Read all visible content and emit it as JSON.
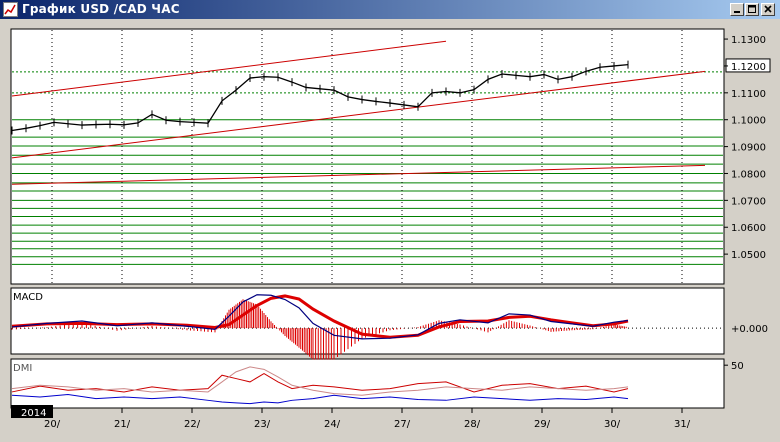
{
  "window": {
    "title": "График USD /CAD  ЧАС",
    "badge_year": "2014",
    "icons": {
      "app": "chart-app-icon",
      "minimize": "minimize-icon",
      "maximize": "maximize-icon",
      "close": "close-icon"
    }
  },
  "colors": {
    "background": "#ffffff",
    "chrome": "#d4d0c8",
    "price": "#000000",
    "trendline": "#cc0000",
    "level": "#008000",
    "ma_red": "#dd0000",
    "macd_blue": "#000080",
    "dmi_red": "#cc0000",
    "dmi_blue": "#0000cc",
    "dmi_pink": "#cc8888",
    "grid": "#000000"
  },
  "chart_data": [
    {
      "type": "line",
      "panel": "price",
      "xlabels": [
        "20/",
        "21/",
        "22/",
        "23/",
        "24/",
        "27/",
        "28/",
        "29/",
        "30/",
        "31/"
      ],
      "ylim": [
        1.04,
        1.133
      ],
      "yticks": [
        "1.1300",
        "1.1200",
        "1.1100",
        "1.1000",
        "1.0900",
        "1.0800",
        "1.0700",
        "1.0600",
        "1.0500"
      ],
      "last_price_label": "1.1200",
      "price_series": {
        "x": [
          0,
          0.2,
          0.4,
          0.6,
          0.8,
          1.0,
          1.2,
          1.4,
          1.6,
          1.8,
          2.0,
          2.2,
          2.4,
          2.6,
          2.8,
          3.0,
          3.2,
          3.4,
          3.6,
          3.8,
          4.0,
          4.2,
          4.4,
          4.6,
          4.8,
          5.0,
          5.2,
          5.4,
          5.6,
          5.8,
          6.0,
          6.2,
          6.4,
          6.6,
          6.8,
          7.0,
          7.2,
          7.4,
          7.6,
          7.8,
          8.0,
          8.2,
          8.4,
          8.6,
          8.8
        ],
        "y": [
          1.096,
          1.0968,
          1.0978,
          1.099,
          1.0985,
          1.098,
          1.0982,
          1.0983,
          1.0981,
          1.0988,
          1.102,
          1.0998,
          1.0993,
          1.099,
          1.0987,
          1.107,
          1.111,
          1.1155,
          1.116,
          1.1158,
          1.114,
          1.112,
          1.1115,
          1.111,
          1.1085,
          1.1075,
          1.1068,
          1.1062,
          1.1055,
          1.1048,
          1.11,
          1.1105,
          1.11,
          1.1112,
          1.115,
          1.117,
          1.1165,
          1.116,
          1.1168,
          1.115,
          1.116,
          1.118,
          1.1195,
          1.12,
          1.1205
        ]
      },
      "trend_lines": [
        {
          "x": [
            0,
            6.2
          ],
          "y": [
            1.1088,
            1.1292
          ]
        },
        {
          "x": [
            0,
            9.9
          ],
          "y": [
            1.0858,
            1.118
          ]
        },
        {
          "x": [
            0,
            9.9
          ],
          "y": [
            1.076,
            1.083
          ]
        }
      ],
      "horizontal_levels": [
        1.1178,
        1.11,
        1.1,
        1.0935,
        1.0902,
        1.0868,
        1.0835,
        1.08,
        1.0765,
        1.0735,
        1.07,
        1.067,
        1.064,
        1.0608,
        1.0578,
        1.0548,
        1.052,
        1.049,
        1.0462
      ]
    },
    {
      "type": "line",
      "panel": "macd",
      "title": "MACD",
      "ylim": [
        -0.001,
        0.0016
      ],
      "yticks": [
        "+0.000"
      ],
      "x": [
        0,
        0.5,
        1.0,
        1.5,
        2.0,
        2.5,
        2.9,
        3.1,
        3.3,
        3.5,
        3.7,
        3.9,
        4.1,
        4.3,
        4.6,
        5.0,
        5.4,
        5.8,
        6.1,
        6.4,
        6.8,
        7.1,
        7.4,
        7.7,
        8.0,
        8.3,
        8.6,
        8.8
      ],
      "series": [
        {
          "values": [
            8e-05,
            0.00018,
            0.0002,
            0.00015,
            0.00018,
            0.00012,
            3e-05,
            0.00015,
            0.00055,
            0.00095,
            0.00125,
            0.00135,
            0.00122,
            0.0008,
            0.0003,
            -0.00025,
            -0.00038,
            -0.0003,
            5e-05,
            0.00028,
            0.0003,
            0.00045,
            0.0005,
            0.00035,
            0.00022,
            0.0001,
            0.00018,
            0.0003
          ]
        },
        {
          "values": [
            5e-05,
            0.0002,
            0.0003,
            0.0001,
            0.00022,
            8e-05,
            -5e-05,
            0.0005,
            0.0011,
            0.0014,
            0.00138,
            0.0012,
            0.00085,
            0.0002,
            -0.0003,
            -0.00045,
            -0.00042,
            -0.00028,
            0.0002,
            0.00035,
            0.00022,
            0.0006,
            0.00055,
            0.00028,
            0.00018,
            8e-05,
            0.00025,
            0.00032
          ]
        }
      ]
    },
    {
      "type": "line",
      "panel": "dmi",
      "title": "DMI",
      "ylim": [
        0,
        55
      ],
      "yticks": [
        "50"
      ],
      "x": [
        0,
        0.4,
        0.8,
        1.2,
        1.6,
        2.0,
        2.4,
        2.8,
        3.0,
        3.2,
        3.4,
        3.6,
        3.8,
        4.0,
        4.3,
        4.6,
        5.0,
        5.4,
        5.8,
        6.2,
        6.6,
        7.0,
        7.4,
        7.8,
        8.2,
        8.6,
        8.8
      ],
      "series": [
        {
          "values": [
            18,
            25,
            20,
            22,
            18,
            24,
            20,
            22,
            38,
            34,
            30,
            40,
            30,
            22,
            26,
            24,
            20,
            22,
            28,
            30,
            18,
            26,
            28,
            22,
            25,
            18,
            22
          ]
        },
        {
          "values": [
            14,
            12,
            15,
            10,
            12,
            10,
            12,
            8,
            6,
            5,
            4,
            6,
            5,
            8,
            10,
            14,
            10,
            12,
            9,
            8,
            12,
            10,
            8,
            10,
            9,
            12,
            10
          ]
        },
        {
          "values": [
            22,
            26,
            24,
            20,
            22,
            18,
            20,
            18,
            30,
            42,
            48,
            45,
            36,
            26,
            20,
            16,
            14,
            18,
            20,
            24,
            22,
            20,
            24,
            22,
            20,
            22,
            24
          ]
        }
      ]
    }
  ]
}
